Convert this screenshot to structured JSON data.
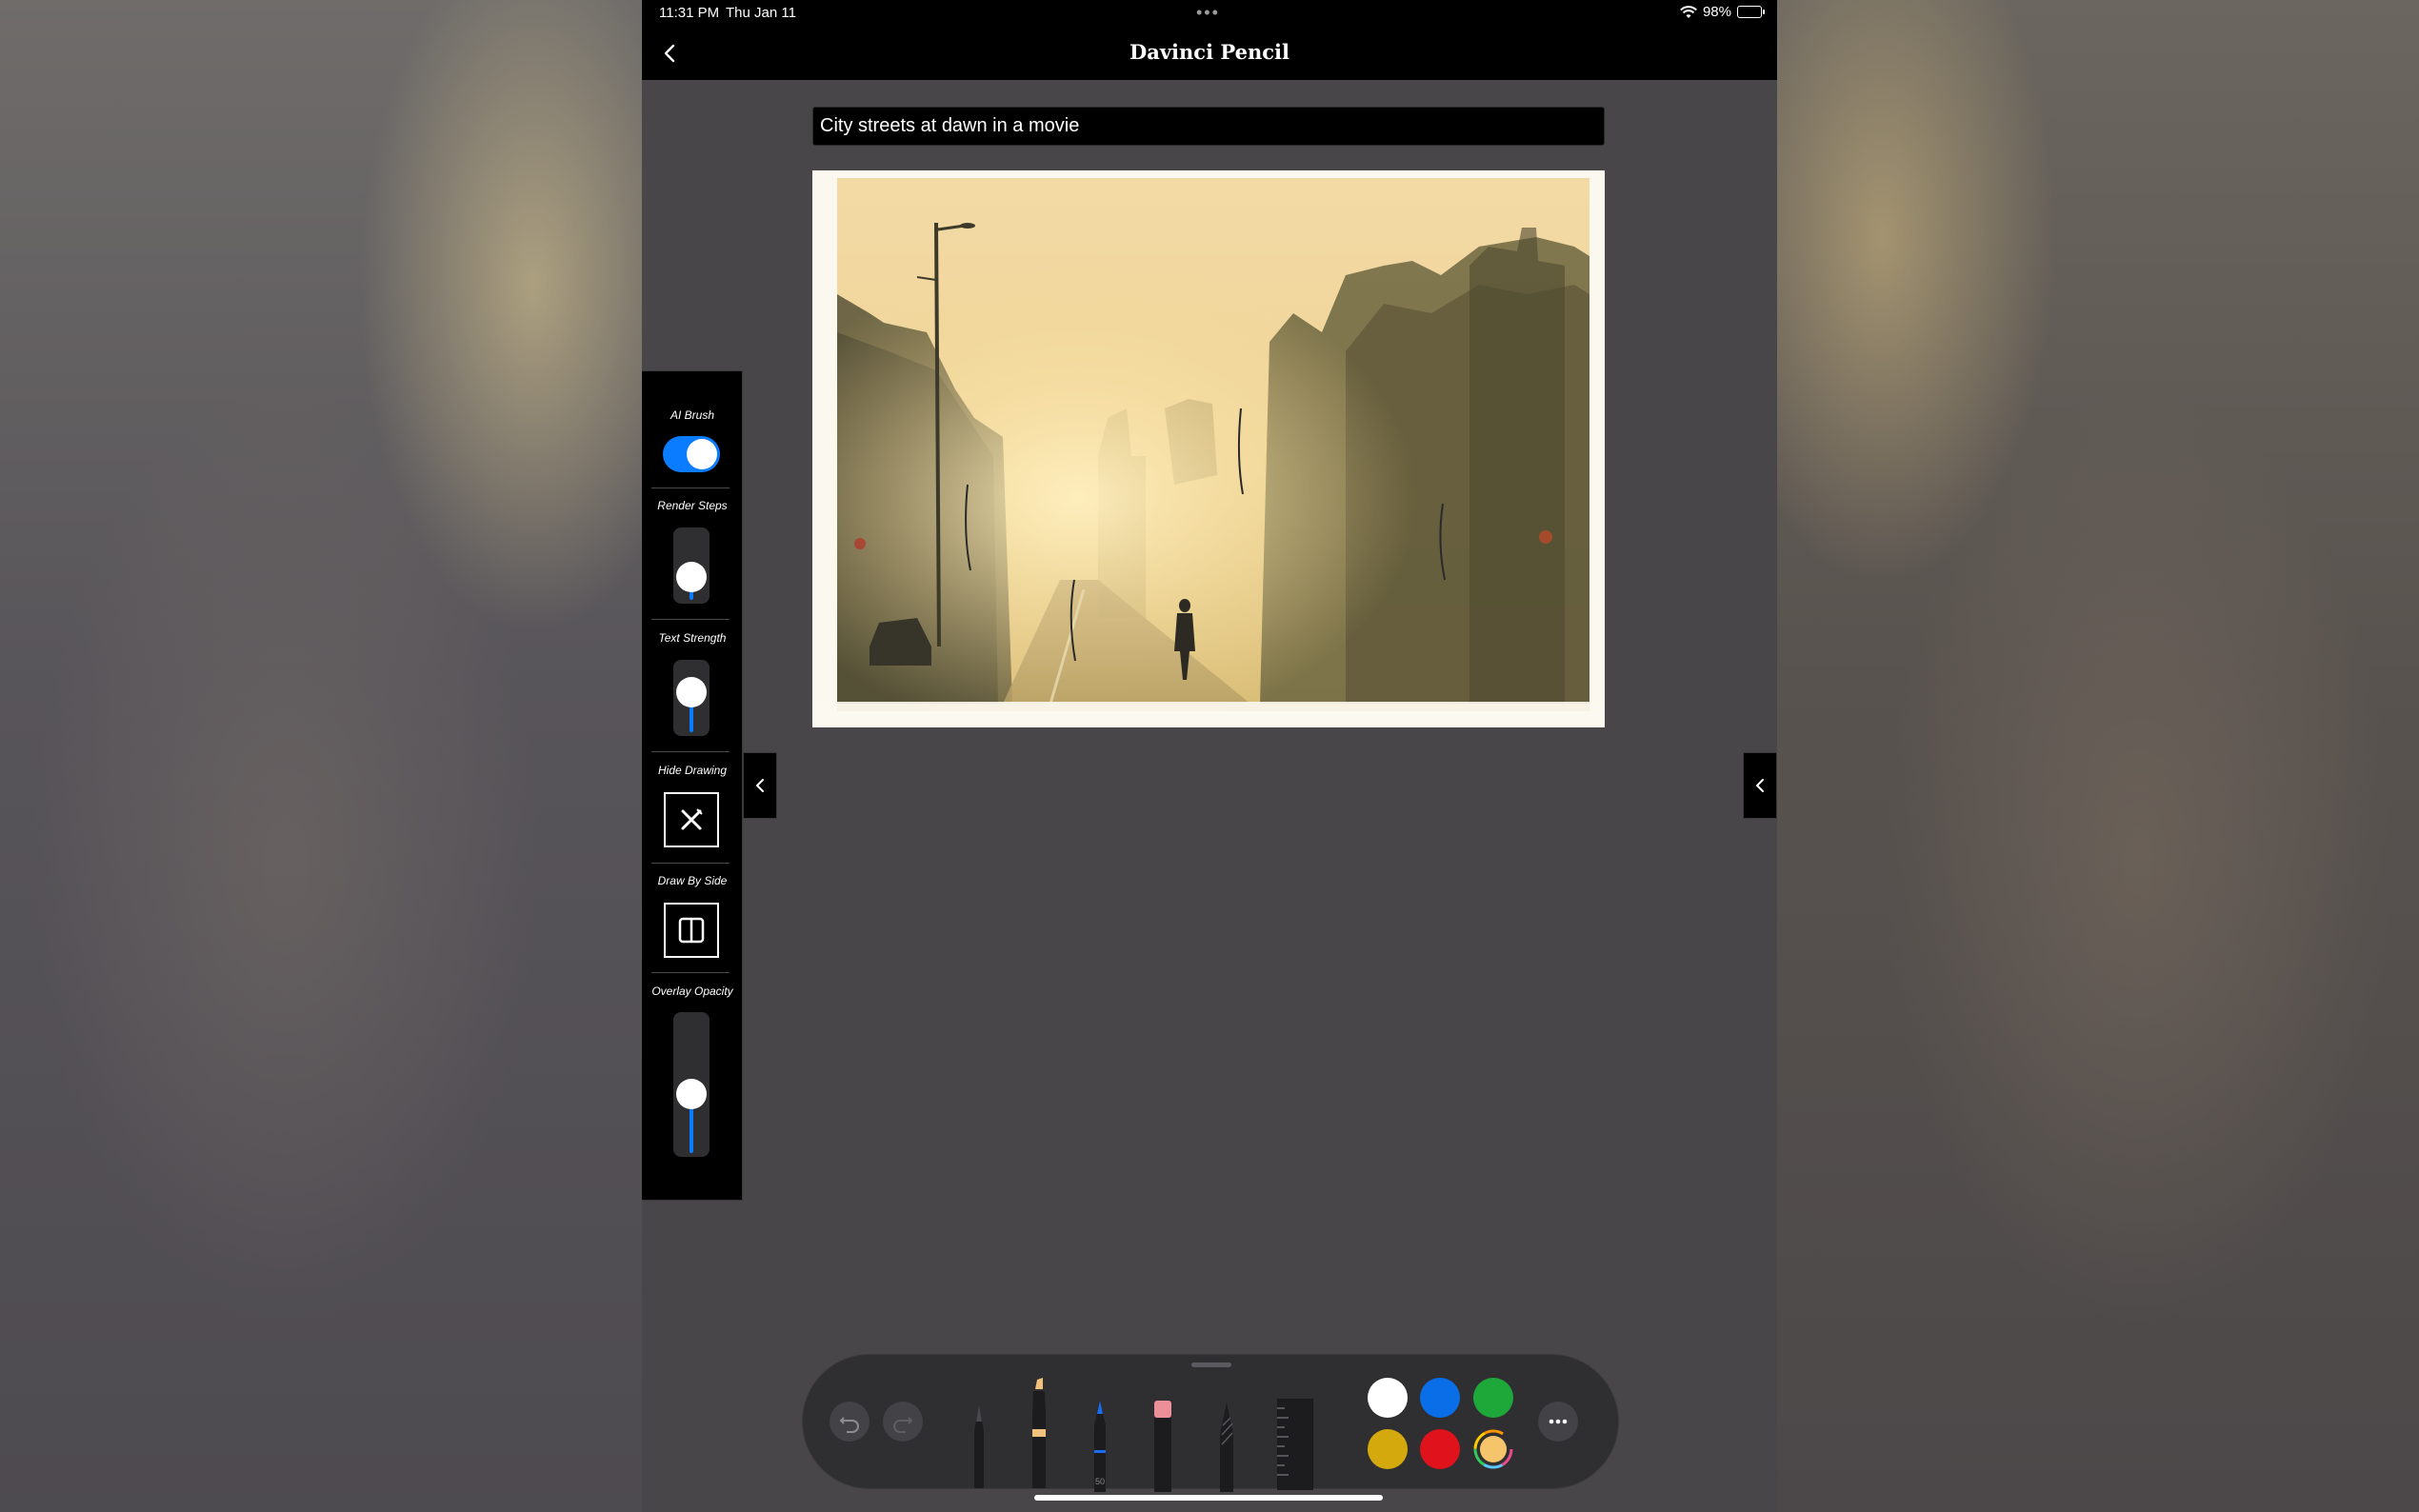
{
  "status_bar": {
    "time": "11:31 PM",
    "date": "Thu Jan 11",
    "battery": "98%",
    "multitask_indicator": "•••"
  },
  "nav": {
    "title": "Davinci Pencil",
    "back_icon": "chevron-left-icon"
  },
  "prompt": {
    "value": "City streets at dawn in a movie"
  },
  "canvas": {
    "image_description_icon": "generated-artwork"
  },
  "side_panel": {
    "ai_brush": {
      "label": "AI Brush",
      "enabled": true
    },
    "render_steps": {
      "label": "Render Steps",
      "level": 0.3
    },
    "text_strength": {
      "label": "Text Strength",
      "level": 0.5
    },
    "hide_drawing": {
      "label": "Hide Drawing",
      "icon": "hide-drawing-icon"
    },
    "draw_by_side": {
      "label": "Draw By Side",
      "icon": "split-view-icon"
    },
    "overlay_opacity": {
      "label": "Overlay Opacity",
      "level": 0.45
    },
    "collapse_icon": "chevron-left-icon"
  },
  "tool_palette": {
    "undo_icon": "undo-icon",
    "redo_icon": "redo-icon",
    "tools": [
      "pen-icon",
      "marker-icon",
      "pencil-icon",
      "eraser-icon",
      "lasso-icon",
      "ruler-icon"
    ],
    "pencil_width_label": "50",
    "colors": [
      "#ffffff",
      "#0a6ee8",
      "#1fa83a",
      "#d4a90d",
      "#e0121c",
      "#f5c46b"
    ],
    "more_icon": "ellipsis-icon"
  }
}
